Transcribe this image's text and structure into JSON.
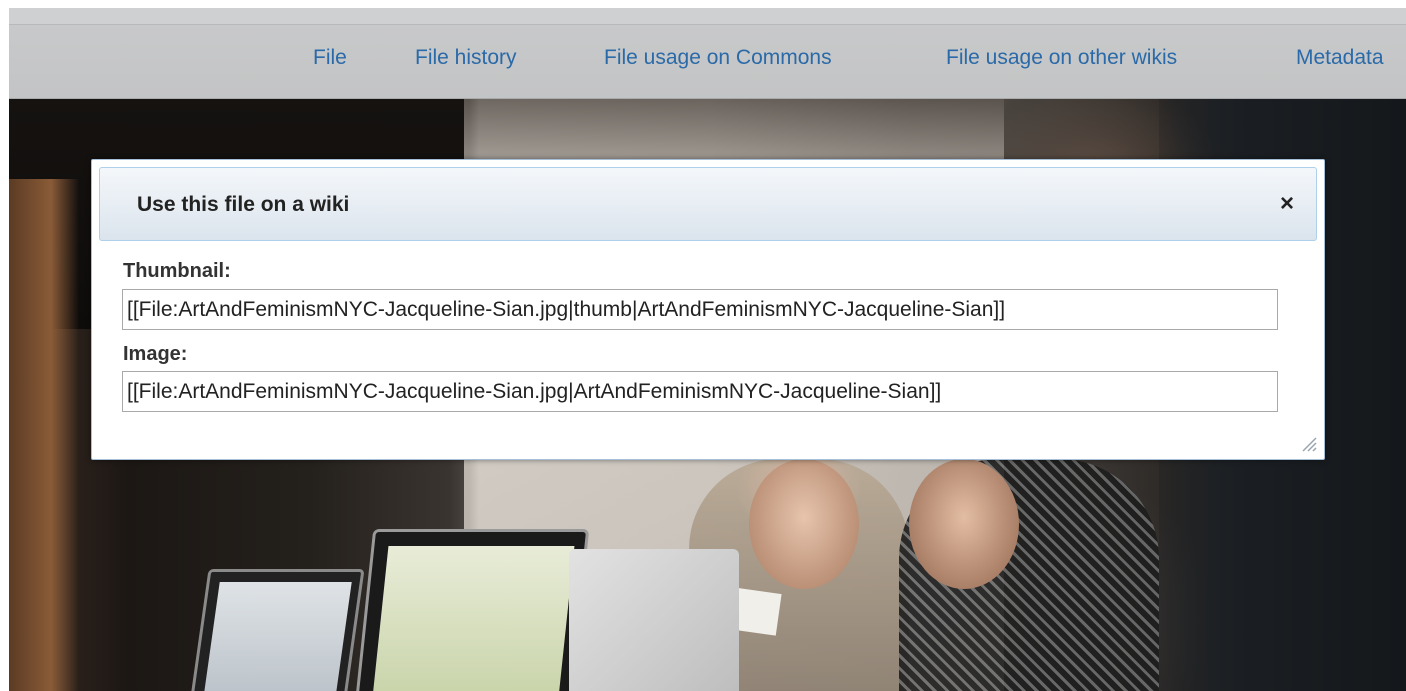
{
  "tabs": [
    {
      "label": "File"
    },
    {
      "label": "File history"
    },
    {
      "label": "File usage on Commons"
    },
    {
      "label": "File usage on other wikis"
    },
    {
      "label": "Metadata"
    }
  ],
  "dialog": {
    "title": "Use this file on a wiki",
    "close_icon": "close-icon",
    "close_glyph": "×",
    "thumbnail": {
      "label": "Thumbnail:",
      "value": "[[File:ArtAndFeminismNYC-Jacqueline-Sian.jpg|thumb|ArtAndFeminismNYC-Jacqueline-Sian]]"
    },
    "image": {
      "label": "Image:",
      "value": "[[File:ArtAndFeminismNYC-Jacqueline-Sian.jpg|ArtAndFeminismNYC-Jacqueline-Sian]]"
    },
    "resize_icon": "resize-grip-icon"
  },
  "colors": {
    "tab_link": "#2a6aa8",
    "dialog_border": "#a7c0d9",
    "titlebar_border": "#aed0ea"
  }
}
